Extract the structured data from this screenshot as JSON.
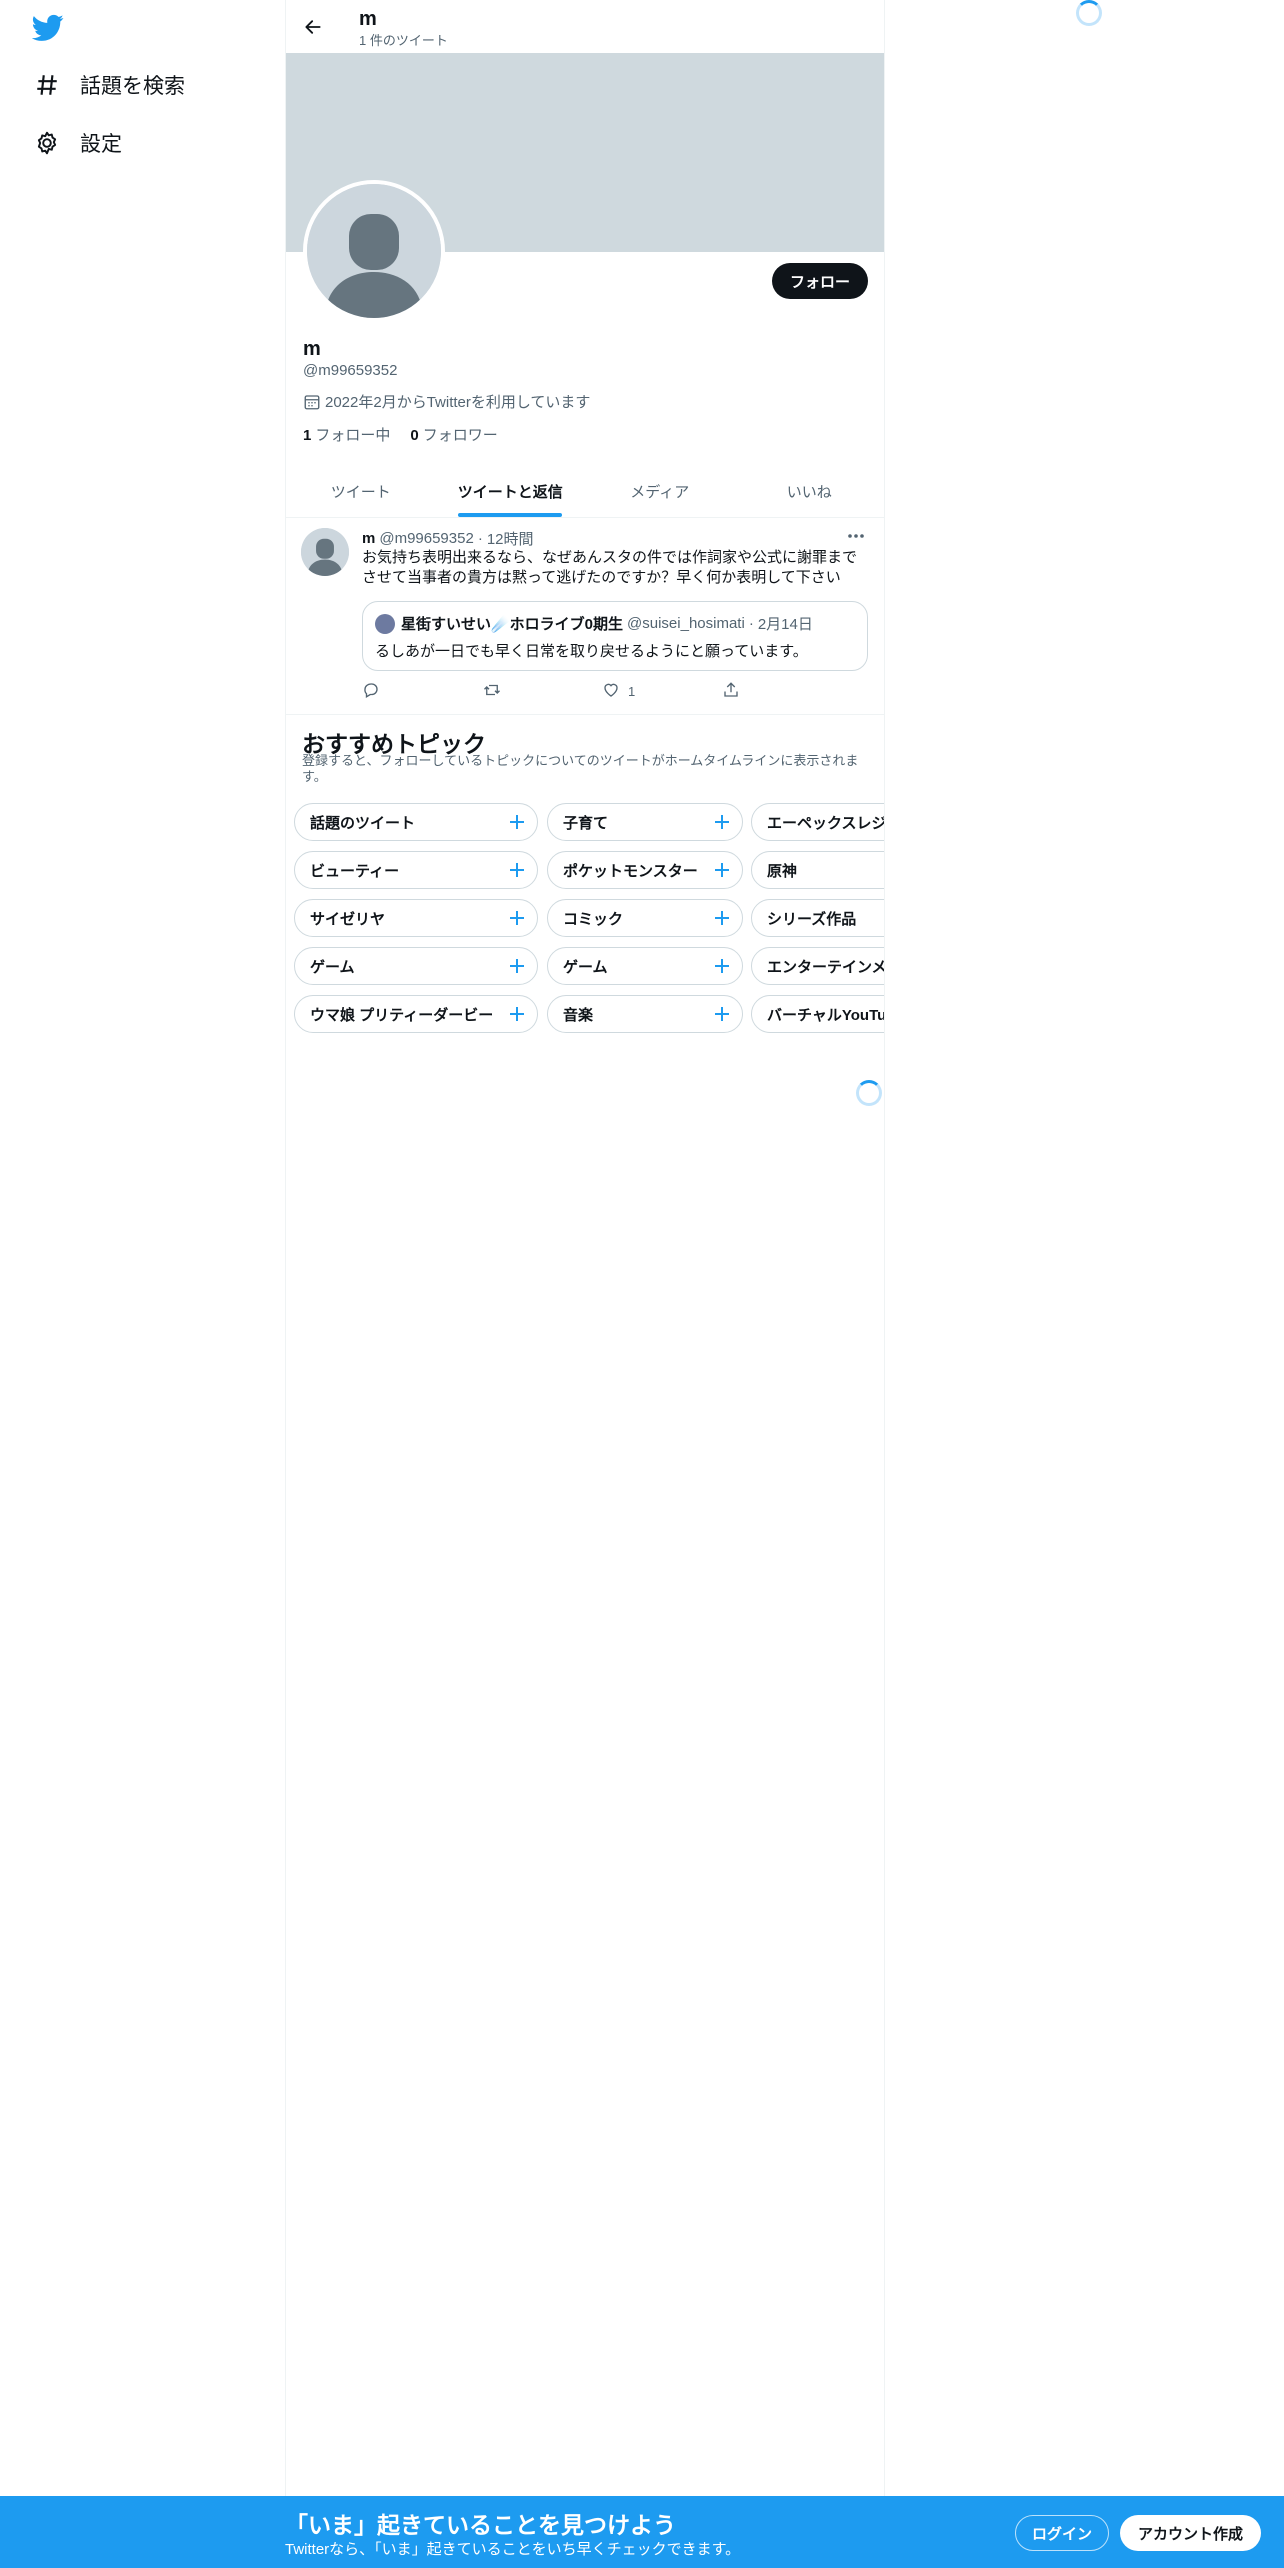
{
  "sidebar": {
    "logo_icon": "twitter-bird-icon",
    "items": [
      {
        "label": "話題を検索",
        "icon": "hashtag-icon"
      },
      {
        "label": "設定",
        "icon": "gear-icon"
      }
    ]
  },
  "header": {
    "title": "m",
    "subtitle": "1 件のツイート",
    "back_icon": "back-arrow-icon"
  },
  "profile": {
    "follow_label": "フォロー",
    "name": "m",
    "handle": "@m99659352",
    "joined": "2022年2月からTwitterを利用しています",
    "following_count": "1",
    "following_label": "フォロー中",
    "followers_count": "0",
    "followers_label": "フォロワー"
  },
  "tabs": [
    {
      "label": "ツイート",
      "active": false
    },
    {
      "label": "ツイートと返信",
      "active": true
    },
    {
      "label": "メディア",
      "active": false
    },
    {
      "label": "いいね",
      "active": false
    }
  ],
  "tweet": {
    "name": "m",
    "handle": "@m99659352",
    "sep": "·",
    "time": "12時間",
    "text": "お気持ち表明出来るなら、なぜあんスタの件では作詞家や公式に謝罪までさせて当事者の貴方は黙って逃げたのですか？早く何か表明して下さい",
    "quote": {
      "name": "星街すいせい☄️ホロライブ0期生",
      "handle": "@suisei_hosimati",
      "sep": "·",
      "date": "2月14日",
      "text": "るしあが一日でも早く日常を取り戻せるようにと願っています。"
    },
    "actions": {
      "reply_count": "",
      "retweet_count": "",
      "like_count": "1"
    }
  },
  "topics": {
    "title": "おすすめトピック",
    "description": "登録すると、フォローしているトピックについてのツイートがホームタイムラインに表示されます。",
    "rows": [
      [
        "話題のツイート",
        "子育て",
        "エーペックスレジェンズ"
      ],
      [
        "ビューティー",
        "ポケットモンスター",
        "原神"
      ],
      [
        "サイゼリヤ",
        "コミック",
        "シリーズ作品"
      ],
      [
        "ゲーム",
        "ゲーム",
        "エンターテインメント"
      ],
      [
        "ウマ娘 プリティーダービー",
        "音楽",
        "バーチャルYouTuber"
      ]
    ]
  },
  "bottom_bar": {
    "title": "「いま」起きていることを見つけよう",
    "subtitle": "Twitterなら、「いま」起きていることをいち早くチェックできます。",
    "login_label": "ログイン",
    "signup_label": "アカウント作成"
  },
  "colors": {
    "accent": "#1d9bf0",
    "text": "#0f1419",
    "muted": "#536471",
    "banner": "#cfd9de"
  }
}
